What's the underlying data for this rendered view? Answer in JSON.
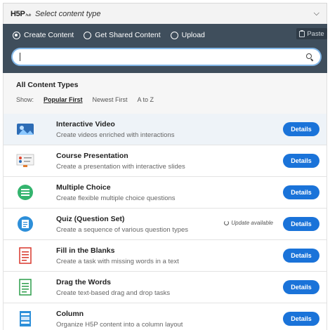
{
  "header": {
    "logo": "H5P",
    "logo_sub": "hub",
    "title": "Select content type"
  },
  "tabs": [
    {
      "label": "Create Content",
      "checked": true
    },
    {
      "label": "Get Shared Content",
      "checked": false
    },
    {
      "label": "Upload",
      "checked": false
    }
  ],
  "paste": {
    "label": "Paste"
  },
  "search": {
    "value": "",
    "placeholder": ""
  },
  "section": {
    "title": "All Content Types",
    "show_label": "Show:",
    "sort_options": [
      "Popular First",
      "Newest First",
      "A to Z"
    ],
    "active_sort": "Popular First"
  },
  "items": [
    {
      "title": "Interactive Video",
      "desc": "Create videos enriched with interactions",
      "button": "Details",
      "update": "",
      "icon": "interactive-video-icon"
    },
    {
      "title": "Course Presentation",
      "desc": "Create a presentation with interactive slides",
      "button": "Details",
      "update": "",
      "icon": "course-presentation-icon"
    },
    {
      "title": "Multiple Choice",
      "desc": "Create flexible multiple choice questions",
      "button": "Details",
      "update": "",
      "icon": "multiple-choice-icon"
    },
    {
      "title": "Quiz (Question Set)",
      "desc": "Create a sequence of various question types",
      "button": "Details",
      "update": "Update available",
      "icon": "quiz-icon"
    },
    {
      "title": "Fill in the Blanks",
      "desc": "Create a task with missing words in a text",
      "button": "Details",
      "update": "",
      "icon": "fill-blanks-icon"
    },
    {
      "title": "Drag the Words",
      "desc": "Create text-based drag and drop tasks",
      "button": "Details",
      "update": "",
      "icon": "drag-words-icon"
    },
    {
      "title": "Column",
      "desc": "Organize H5P content into a column layout",
      "button": "Details",
      "update": "",
      "icon": "column-icon"
    }
  ],
  "colors": {
    "accent": "#1a73d9",
    "panel": "#3f4e5c",
    "search_glow": "#82b7e8",
    "row_highlight": "#eef3f8"
  }
}
